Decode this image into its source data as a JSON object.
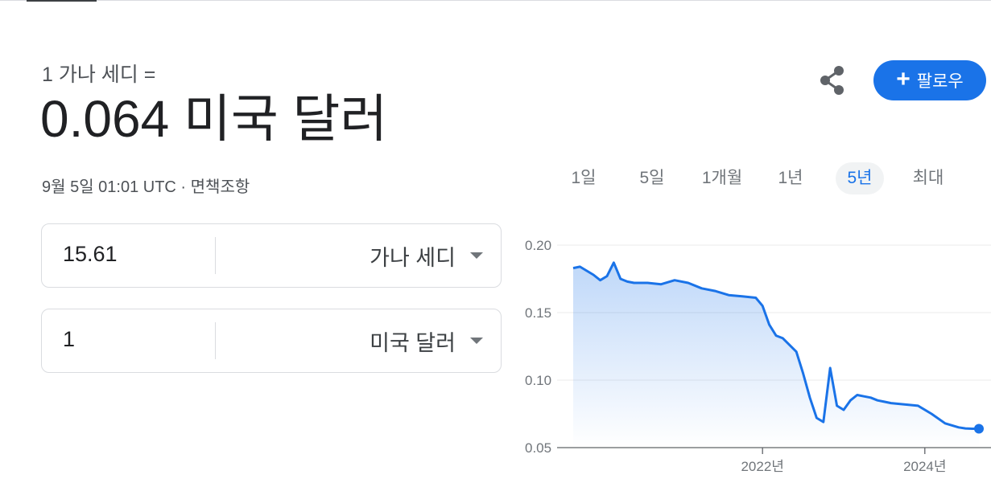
{
  "header": {
    "subtitle": "1 가나 세디 =",
    "headline": "0.064 미국 달러",
    "timestamp": "9월 5일 01:01 UTC · ",
    "disclaimer": "면책조항"
  },
  "actions": {
    "share_icon": "share-icon",
    "follow_label": "팔로우",
    "follow_icon": "+",
    "accent": "#1a73e8"
  },
  "converter": {
    "from": {
      "amount": "15.61",
      "currency": "가나 세디"
    },
    "to": {
      "amount": "1",
      "currency": "미국 달러"
    }
  },
  "ranges": [
    "1일",
    "5일",
    "1개월",
    "1년",
    "5년",
    "최대"
  ],
  "active_range": "5년",
  "chart_data": {
    "type": "area",
    "title": "",
    "xlabel": "",
    "ylabel": "",
    "ylim": [
      0.05,
      0.2
    ],
    "yticks": [
      "0.20",
      "0.15",
      "0.10",
      "0.05"
    ],
    "xticks": [
      "2022년",
      "2024년"
    ],
    "grid": true,
    "color": "#1a73e8",
    "series": [
      {
        "x": [
          "2019-09",
          "2019-10",
          "2019-12",
          "2020-01",
          "2020-02",
          "2020-03",
          "2020-04",
          "2020-05",
          "2020-06",
          "2020-08",
          "2020-10",
          "2020-12",
          "2021-02",
          "2021-04",
          "2021-06",
          "2021-08",
          "2021-10",
          "2021-12",
          "2022-01",
          "2022-02",
          "2022-03",
          "2022-04",
          "2022-05",
          "2022-06",
          "2022-07",
          "2022-08",
          "2022-09",
          "2022-10",
          "2022-11",
          "2022-12",
          "2023-01",
          "2023-02",
          "2023-03",
          "2023-04",
          "2023-05",
          "2023-06",
          "2023-07",
          "2023-08",
          "2023-10",
          "2023-12",
          "2024-02",
          "2024-04",
          "2024-06",
          "2024-07",
          "2024-08",
          "2024-09"
        ],
        "values": [
          0.183,
          0.184,
          0.178,
          0.174,
          0.177,
          0.187,
          0.175,
          0.173,
          0.172,
          0.172,
          0.171,
          0.174,
          0.172,
          0.168,
          0.166,
          0.163,
          0.162,
          0.161,
          0.155,
          0.141,
          0.133,
          0.131,
          0.126,
          0.121,
          0.105,
          0.087,
          0.072,
          0.069,
          0.109,
          0.081,
          0.078,
          0.085,
          0.089,
          0.088,
          0.087,
          0.085,
          0.084,
          0.083,
          0.082,
          0.081,
          0.075,
          0.068,
          0.065,
          0.0642,
          0.064,
          0.064
        ]
      }
    ]
  }
}
